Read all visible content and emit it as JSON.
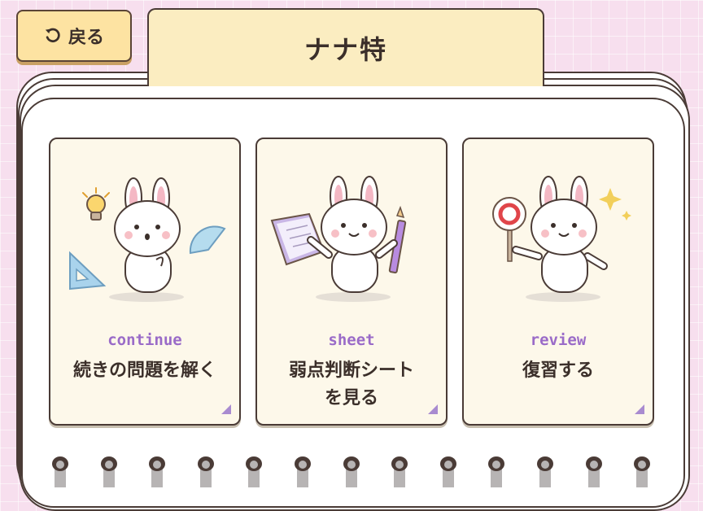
{
  "header": {
    "back_label": "戻る",
    "title": "ナナ特"
  },
  "cards": [
    {
      "eng": "continue",
      "label": "続きの問題を解く",
      "label_line2": ""
    },
    {
      "eng": "sheet",
      "label": "弱点判断シート",
      "label_line2": "を見る"
    },
    {
      "eng": "review",
      "label": "復習する",
      "label_line2": ""
    }
  ],
  "colors": {
    "background": "#f7dfee",
    "button": "#fde3a2",
    "tab": "#fbedc1",
    "card": "#fdf8ea",
    "accent_purple": "#9a6bc8",
    "outline": "#4a3b36"
  },
  "icons": [
    "undo-icon",
    "lightbulb-icon",
    "triangle-ruler-icon",
    "protractor-icon",
    "open-book-icon",
    "pencil-icon",
    "maru-paddle-icon",
    "sparkle-icon",
    "rabbit-icon"
  ]
}
